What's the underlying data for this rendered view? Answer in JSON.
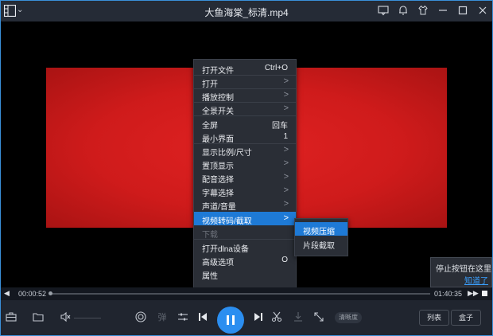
{
  "window": {
    "title": "大鱼海棠_标清.mp4"
  },
  "context_menu": {
    "items": [
      {
        "label": "打开文件",
        "shortcut": "Ctrl+O",
        "submenu": false,
        "separator_after": true
      },
      {
        "label": "打开",
        "shortcut": "",
        "submenu": true,
        "separator_after": true
      },
      {
        "label": "播放控制",
        "shortcut": "",
        "submenu": true,
        "separator_after": true
      },
      {
        "label": "全景开关",
        "shortcut": "",
        "submenu": true,
        "separator_after": true
      },
      {
        "label": "全屏",
        "shortcut": "回车",
        "submenu": false,
        "separator_after": false
      },
      {
        "label": "最小界面",
        "shortcut": "1",
        "submenu": false,
        "separator_after": true
      },
      {
        "label": "显示比例/尺寸",
        "shortcut": "",
        "submenu": true,
        "separator_after": false
      },
      {
        "label": "置顶显示",
        "shortcut": "",
        "submenu": true,
        "separator_after": false
      },
      {
        "label": "配音选择",
        "shortcut": "",
        "submenu": true,
        "separator_after": false
      },
      {
        "label": "字幕选择",
        "shortcut": "",
        "submenu": true,
        "separator_after": false
      },
      {
        "label": "声道/音量",
        "shortcut": "",
        "submenu": true,
        "separator_after": false
      },
      {
        "label": "视频转码/截取",
        "shortcut": "",
        "submenu": true,
        "separator_after": false,
        "highlighted": true
      },
      {
        "label": "下载",
        "shortcut": "",
        "submenu": false,
        "separator_after": true,
        "disabled": true
      },
      {
        "label": "打开dlna设备",
        "shortcut": "",
        "submenu": false,
        "separator_after": false
      },
      {
        "label": "高级选项",
        "shortcut": "O",
        "submenu": false,
        "separator_after": false
      },
      {
        "label": "属性",
        "shortcut": "",
        "submenu": false,
        "separator_after": false
      }
    ],
    "arrow_glyph": ">"
  },
  "submenu": {
    "items": [
      "视频压缩",
      "片段截取"
    ]
  },
  "tooltip": {
    "text": "停止按钮在这里",
    "link": "知道了"
  },
  "progress": {
    "current_time": "00:00:52",
    "total_time": "01:40:35",
    "played_fraction": 0.009
  },
  "controls": {
    "danmaku_label": "弹",
    "quality_label": "清晰度",
    "playlist_label": "列表",
    "box_label": "盒子"
  },
  "colors": {
    "accent": "#2b8ef0",
    "highlight": "#1e7ad6",
    "video_frame": "#d41d1d",
    "link": "#3aa0ff"
  }
}
